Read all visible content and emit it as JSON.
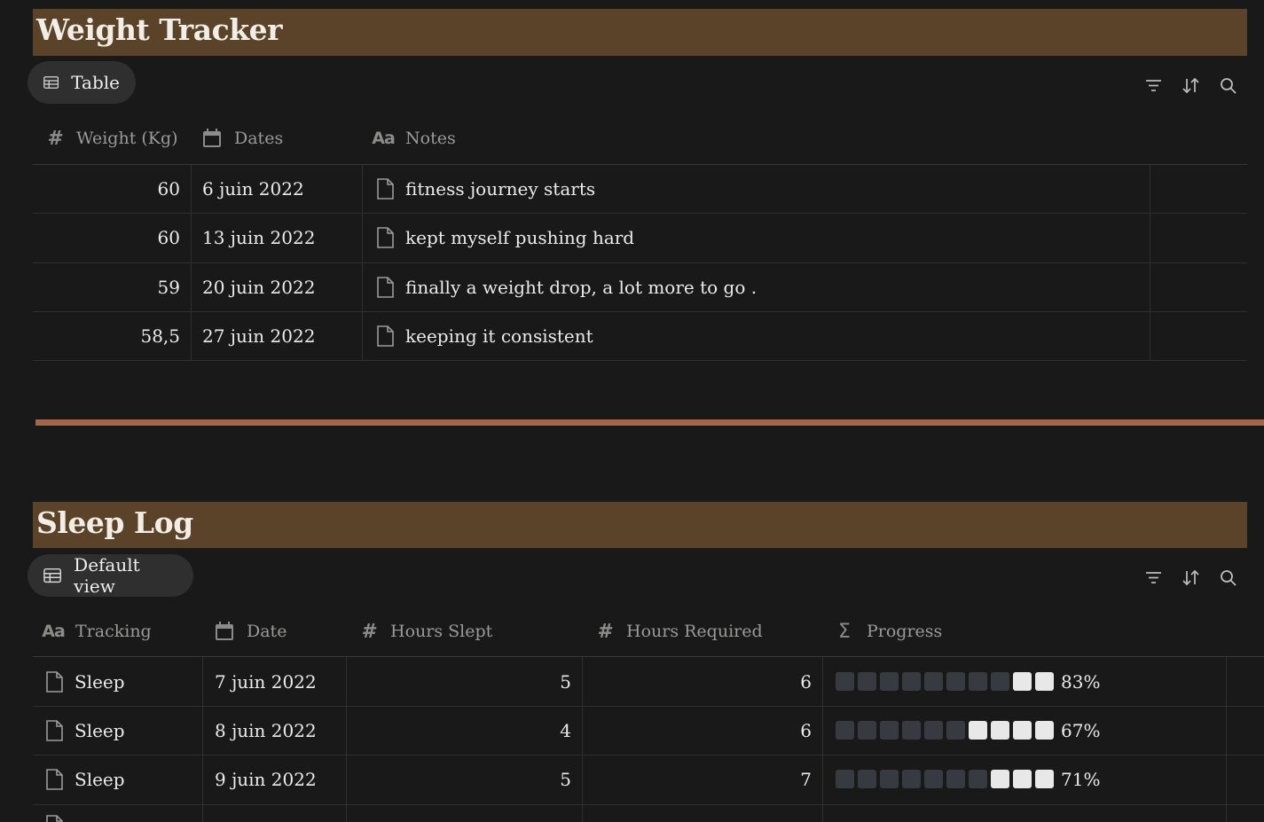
{
  "weight": {
    "title": "Weight Tracker",
    "view_label": "Table",
    "columns": [
      "Weight (Kg)",
      "Dates",
      "Notes"
    ],
    "rows": [
      {
        "weight": "60",
        "date": "6 juin 2022",
        "note": "fitness journey starts"
      },
      {
        "weight": "60",
        "date": "13 juin 2022",
        "note": "kept myself pushing hard"
      },
      {
        "weight": "59",
        "date": "20 juin 2022",
        "note": "finally a weight drop, a lot more to go ."
      },
      {
        "weight": "58,5",
        "date": "27 juin 2022",
        "note": "keeping it consistent"
      }
    ]
  },
  "sleep": {
    "title": "Sleep Log",
    "view_label": "Default view",
    "columns": [
      "Tracking",
      "Date",
      "Hours Slept",
      "Hours Required",
      "Progress"
    ],
    "rows": [
      {
        "tracking": "Sleep",
        "date": "7 juin 2022",
        "slept": "5",
        "required": "6",
        "progress_pct": 83,
        "progress_label": "83%"
      },
      {
        "tracking": "Sleep",
        "date": "8 juin 2022",
        "slept": "4",
        "required": "6",
        "progress_pct": 67,
        "progress_label": "67%"
      },
      {
        "tracking": "Sleep",
        "date": "9 juin 2022",
        "slept": "5",
        "required": "7",
        "progress_pct": 71,
        "progress_label": "71%"
      }
    ]
  },
  "icons": {
    "view": "table-icon",
    "filter": "filter-icon",
    "sort": "sort-icon",
    "search": "search-icon",
    "number": "hash-icon",
    "date": "calendar-icon",
    "text": "text-icon",
    "formula": "sigma-icon",
    "page": "page-icon"
  },
  "colors": {
    "background": "#191919",
    "banner": "#5a4328",
    "divider": "#a2664a",
    "progress_on": "#e8e8e8",
    "progress_off": "#373b41"
  }
}
